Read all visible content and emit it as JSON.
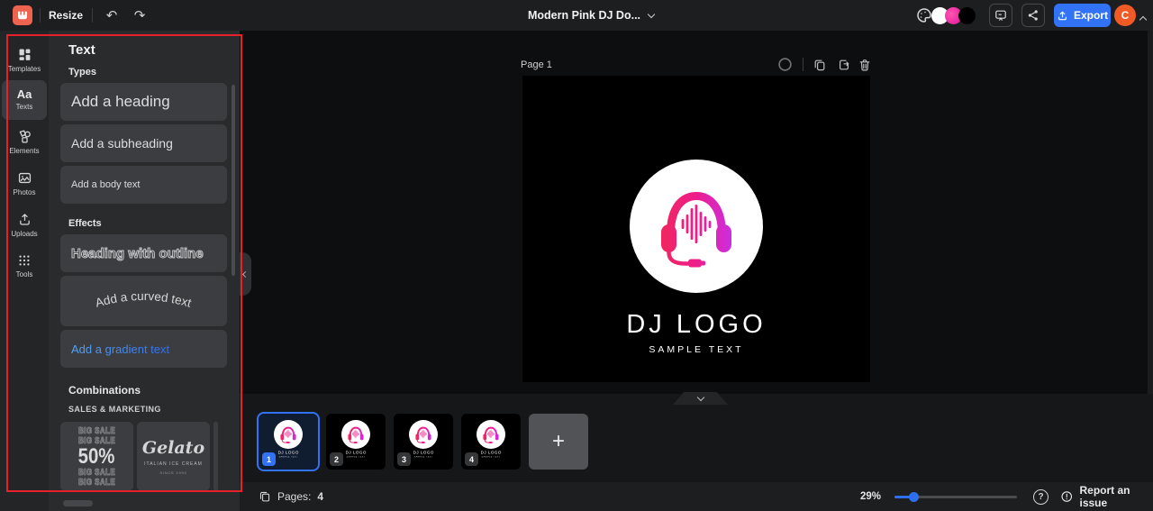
{
  "topbar": {
    "resize_label": "Resize",
    "undo_glyph": "↶",
    "redo_glyph": "↷",
    "document_title": "Modern Pink DJ Do...",
    "export_label": "Export",
    "avatar_initial": "C",
    "palette_colors": [
      "#ffffff",
      "#ec1e9b",
      "#000000"
    ],
    "brand_color": "#ee6250"
  },
  "sidebar": {
    "active_item": "Texts",
    "texts_icon_glyph": "Aa",
    "items": [
      {
        "label": "Templates"
      },
      {
        "label": "Texts"
      },
      {
        "label": "Elements"
      },
      {
        "label": "Photos"
      },
      {
        "label": "Uploads"
      },
      {
        "label": "Tools"
      }
    ]
  },
  "text_panel": {
    "title": "Text",
    "types": {
      "label": "Types",
      "heading": "Add a heading",
      "subheading": "Add a subheading",
      "body": "Add a body text"
    },
    "effects": {
      "label": "Effects",
      "outline": "Heading with outline",
      "curved": "Add a curved text",
      "gradient": "Add a gradient text"
    },
    "combinations": {
      "label": "Combinations",
      "category": "SALES & MARKETING",
      "big_sale_card": {
        "line1": "BIG SALE",
        "line2": "BIG SALE",
        "value": "50%",
        "line3": "BIG SALE",
        "line4": "BIG SALE"
      },
      "gelato_card": {
        "title": "Gelato",
        "subtitle": "ITALIAN ICE CREAM",
        "caption": "SINCE 1990"
      }
    }
  },
  "canvas": {
    "page_label": "Page 1",
    "artboard": {
      "bg": "#000000",
      "logo_title": "DJ LOGO",
      "logo_subtitle": "SAMPLE TEXT"
    }
  },
  "pages_strip": {
    "thumb_title": "DJ LOGO",
    "thumb_subtitle": "SAMPLE TEXT",
    "add_glyph": "+",
    "selected_page": "1",
    "pages": [
      {
        "number": "1"
      },
      {
        "number": "2"
      },
      {
        "number": "3"
      },
      {
        "number": "4"
      }
    ]
  },
  "statusbar": {
    "pages_label": "Pages:",
    "pages_count": "4",
    "zoom_value": "29%",
    "help_glyph": "?",
    "report_label": "Report an issue"
  },
  "colors": {
    "accent_blue": "#3273f5",
    "slider_blue": "#2e6ff0",
    "annotation_red": "#e8202a",
    "avatar_orange": "#f25a25",
    "headphones_gradient": [
      "#f0275c",
      "#ee1d8c",
      "#cb2fe2"
    ]
  }
}
